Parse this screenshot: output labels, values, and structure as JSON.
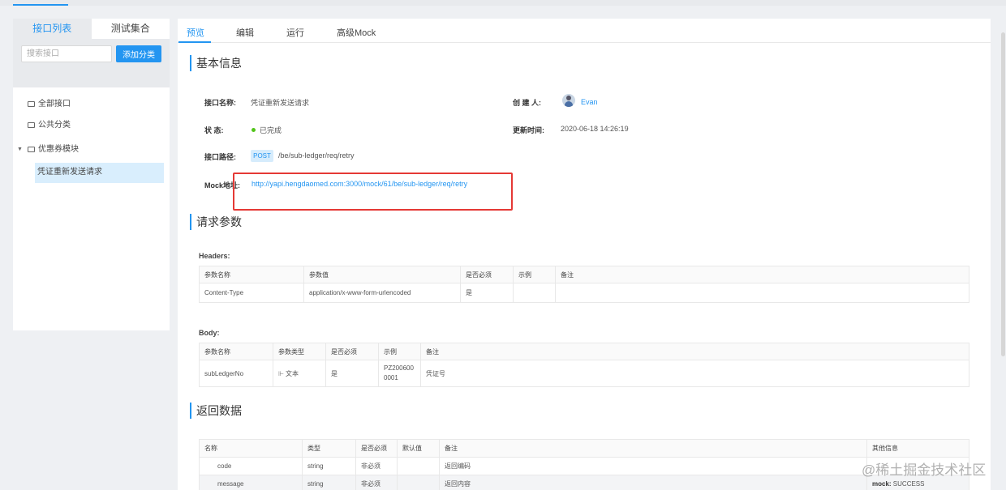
{
  "sidebar": {
    "tabs": [
      "接口列表",
      "测试集合"
    ],
    "search_placeholder": "搜索接口",
    "add_button": "添加分类",
    "items": [
      {
        "label": "全部接口"
      },
      {
        "label": "公共分类"
      },
      {
        "label": "优惠券模块"
      }
    ],
    "selected_leaf": "凭证重新发送请求"
  },
  "tabs": [
    "预览",
    "编辑",
    "运行",
    "高级Mock"
  ],
  "basic": {
    "title": "基本信息",
    "name_label": "接口名称:",
    "name_value": "凭证重新发送请求",
    "creator_label": "创 建 人:",
    "creator_value": "Evan",
    "status_label": "状 态:",
    "status_value": "已完成",
    "updated_label": "更新时间:",
    "updated_value": "2020-06-18 14:26:19",
    "path_label": "接口路径:",
    "method": "POST",
    "path_value": "/be/sub-ledger/req/retry",
    "mock_label": "Mock地址:",
    "mock_value": "http://yapi.hengdaomed.com:3000/mock/61/be/sub-ledger/req/retry"
  },
  "request": {
    "title": "请求参数",
    "headers_label": "Headers:",
    "headers_columns": [
      "参数名称",
      "参数值",
      "是否必须",
      "示例",
      "备注"
    ],
    "headers_rows": [
      {
        "name": "Content-Type",
        "value": "application/x-www-form-urlencoded",
        "required": "是",
        "example": "",
        "note": ""
      }
    ],
    "body_label": "Body:",
    "body_columns": [
      "参数名称",
      "参数类型",
      "是否必须",
      "示例",
      "备注"
    ],
    "body_rows": [
      {
        "name": "subLedgerNo",
        "type": "文本",
        "required": "是",
        "example": "PZ2006000001",
        "note": "凭证号"
      }
    ]
  },
  "response": {
    "title": "返回数据",
    "columns": [
      "名称",
      "类型",
      "是否必须",
      "默认值",
      "备注",
      "其他信息"
    ],
    "rows": [
      {
        "name": "code",
        "type": "string",
        "required": "非必须",
        "default": "",
        "note": "返回编码",
        "mock_key": "",
        "mock_value": ""
      },
      {
        "name": "message",
        "type": "string",
        "required": "非必须",
        "default": "",
        "note": "返回内容",
        "mock_key": "mock:",
        "mock_value": "SUCCESS"
      }
    ]
  },
  "watermark": "@稀土掘金技术社区",
  "colors": {
    "accent": "#2395f1",
    "success": "#52c41a",
    "highlight_box": "#e53935"
  }
}
